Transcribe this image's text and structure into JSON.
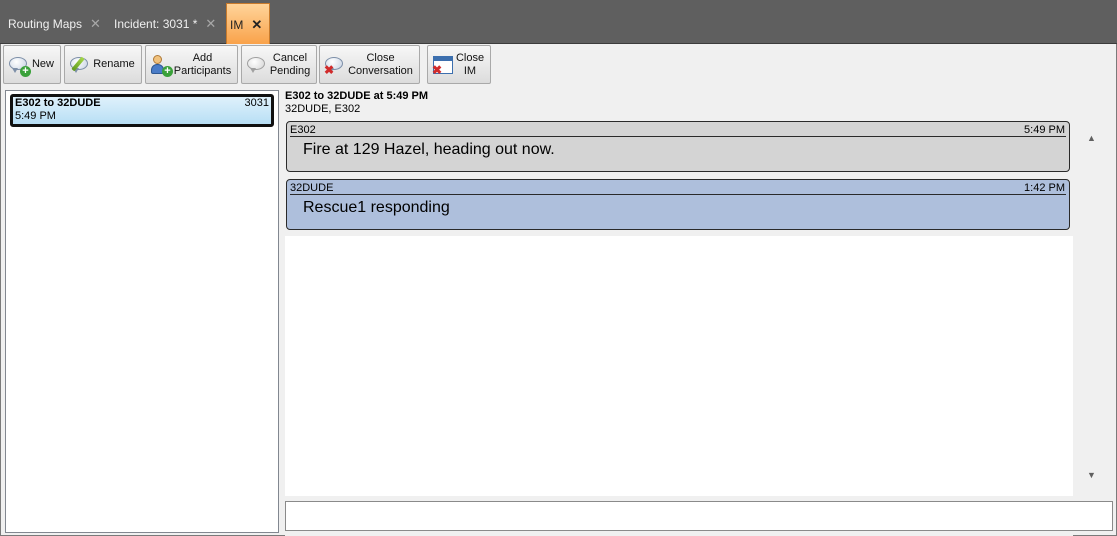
{
  "tabs": [
    {
      "label": "Routing Maps",
      "close": "✕"
    },
    {
      "label": "Incident: 3031 *",
      "close": "✕"
    },
    {
      "label": "IM",
      "close": "✕"
    }
  ],
  "toolbar": {
    "new": "New",
    "rename": "Rename",
    "add_participants": "Add Participants",
    "cancel_pending": "Cancel Pending",
    "close_conversation": "Close Conversation",
    "close_im": "Close IM"
  },
  "conversation_list": [
    {
      "title": "E302 to 32DUDE",
      "number": "3031",
      "time": "5:49 PM"
    }
  ],
  "conversation": {
    "title": "E302 to 32DUDE at 5:49 PM",
    "participants": "32DUDE, E302",
    "messages": [
      {
        "sender": "E302",
        "time": "5:49 PM",
        "text": "Fire at 129 Hazel, heading out now.",
        "bg": "#d4d4d4"
      },
      {
        "sender": "32DUDE",
        "time": "1:42 PM",
        "text": "Rescue1 responding",
        "bg": "#aebfdc"
      }
    ]
  },
  "scroll": {
    "up": "▲",
    "down": "▼"
  },
  "message_input": {
    "value": ""
  },
  "colors": {
    "active_tab": "#f9a24a",
    "selected_item": "#b8dff5"
  }
}
